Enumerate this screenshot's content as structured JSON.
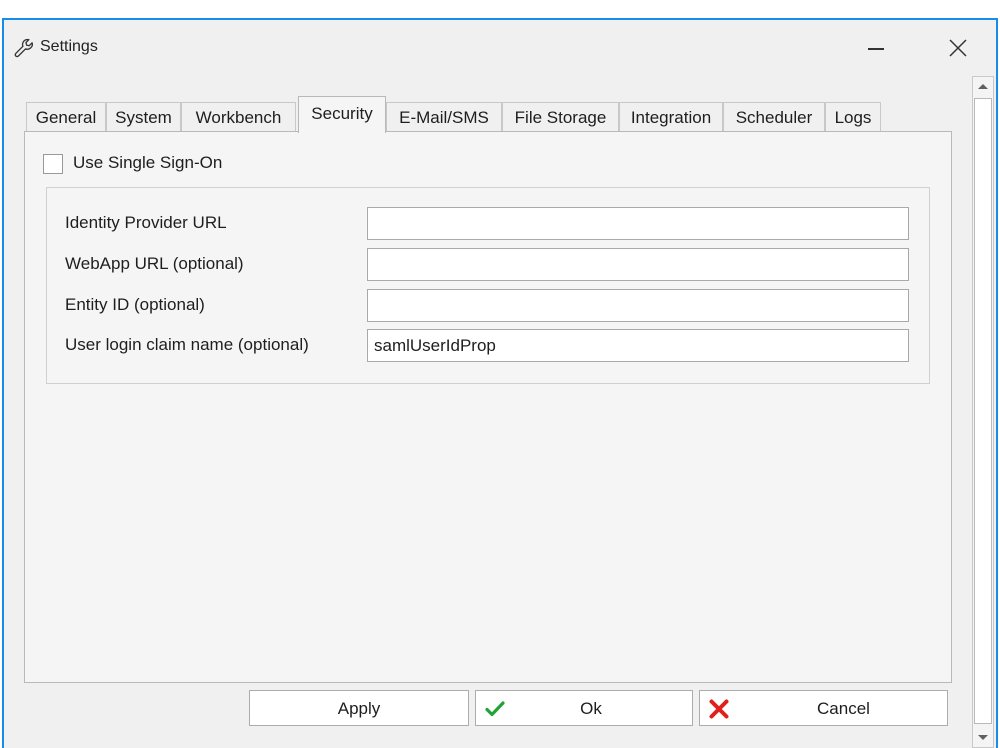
{
  "window": {
    "title": "Settings"
  },
  "tabs": [
    {
      "label": "General",
      "active": false
    },
    {
      "label": "System",
      "active": false
    },
    {
      "label": "Workbench",
      "active": false
    },
    {
      "label": "Security",
      "active": true
    },
    {
      "label": "E-Mail/SMS",
      "active": false
    },
    {
      "label": "File Storage",
      "active": false
    },
    {
      "label": "Integration",
      "active": false
    },
    {
      "label": "Scheduler",
      "active": false
    },
    {
      "label": "Logs",
      "active": false
    }
  ],
  "security": {
    "sso_label": "Use Single Sign-On",
    "sso_checked": false,
    "fields": [
      {
        "label": "Identity Provider URL",
        "value": ""
      },
      {
        "label": "WebApp URL (optional)",
        "value": ""
      },
      {
        "label": "Entity ID (optional)",
        "value": ""
      },
      {
        "label": "User login claim name (optional)",
        "value": "samlUserIdProp"
      }
    ]
  },
  "buttons": {
    "apply": "Apply",
    "ok": "Ok",
    "cancel": "Cancel"
  },
  "colors": {
    "window_border": "#1a8ce8",
    "ok_check": "#22a33a",
    "cancel_x": "#e0201b"
  }
}
